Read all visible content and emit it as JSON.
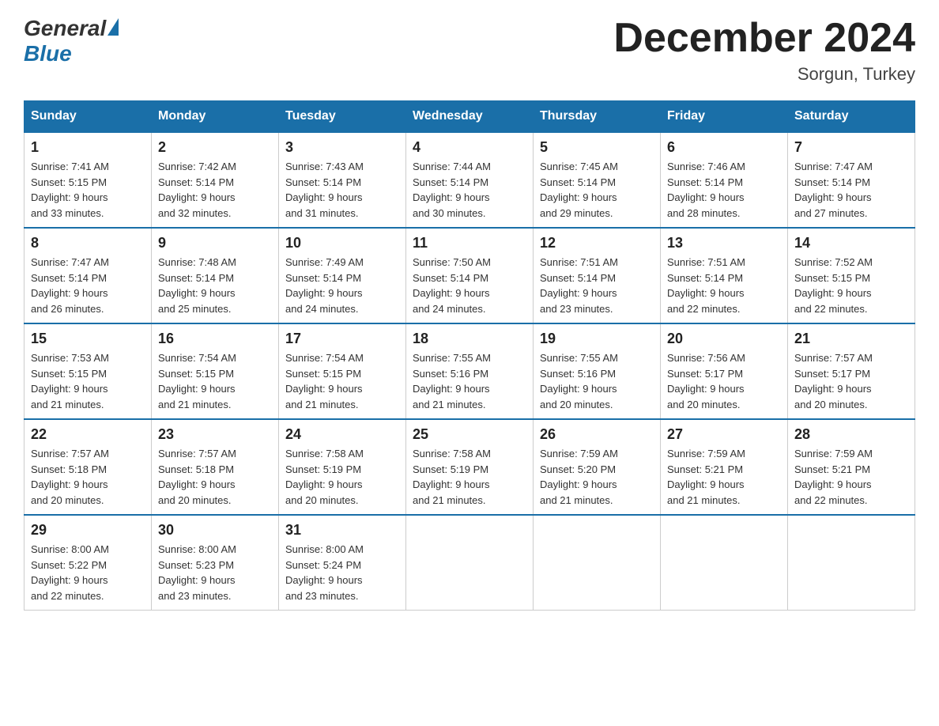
{
  "logo": {
    "general": "General",
    "blue": "Blue"
  },
  "title": "December 2024",
  "location": "Sorgun, Turkey",
  "days_header": [
    "Sunday",
    "Monday",
    "Tuesday",
    "Wednesday",
    "Thursday",
    "Friday",
    "Saturday"
  ],
  "weeks": [
    [
      {
        "day": "1",
        "sunrise": "7:41 AM",
        "sunset": "5:15 PM",
        "daylight": "9 hours and 33 minutes."
      },
      {
        "day": "2",
        "sunrise": "7:42 AM",
        "sunset": "5:14 PM",
        "daylight": "9 hours and 32 minutes."
      },
      {
        "day": "3",
        "sunrise": "7:43 AM",
        "sunset": "5:14 PM",
        "daylight": "9 hours and 31 minutes."
      },
      {
        "day": "4",
        "sunrise": "7:44 AM",
        "sunset": "5:14 PM",
        "daylight": "9 hours and 30 minutes."
      },
      {
        "day": "5",
        "sunrise": "7:45 AM",
        "sunset": "5:14 PM",
        "daylight": "9 hours and 29 minutes."
      },
      {
        "day": "6",
        "sunrise": "7:46 AM",
        "sunset": "5:14 PM",
        "daylight": "9 hours and 28 minutes."
      },
      {
        "day": "7",
        "sunrise": "7:47 AM",
        "sunset": "5:14 PM",
        "daylight": "9 hours and 27 minutes."
      }
    ],
    [
      {
        "day": "8",
        "sunrise": "7:47 AM",
        "sunset": "5:14 PM",
        "daylight": "9 hours and 26 minutes."
      },
      {
        "day": "9",
        "sunrise": "7:48 AM",
        "sunset": "5:14 PM",
        "daylight": "9 hours and 25 minutes."
      },
      {
        "day": "10",
        "sunrise": "7:49 AM",
        "sunset": "5:14 PM",
        "daylight": "9 hours and 24 minutes."
      },
      {
        "day": "11",
        "sunrise": "7:50 AM",
        "sunset": "5:14 PM",
        "daylight": "9 hours and 24 minutes."
      },
      {
        "day": "12",
        "sunrise": "7:51 AM",
        "sunset": "5:14 PM",
        "daylight": "9 hours and 23 minutes."
      },
      {
        "day": "13",
        "sunrise": "7:51 AM",
        "sunset": "5:14 PM",
        "daylight": "9 hours and 22 minutes."
      },
      {
        "day": "14",
        "sunrise": "7:52 AM",
        "sunset": "5:15 PM",
        "daylight": "9 hours and 22 minutes."
      }
    ],
    [
      {
        "day": "15",
        "sunrise": "7:53 AM",
        "sunset": "5:15 PM",
        "daylight": "9 hours and 21 minutes."
      },
      {
        "day": "16",
        "sunrise": "7:54 AM",
        "sunset": "5:15 PM",
        "daylight": "9 hours and 21 minutes."
      },
      {
        "day": "17",
        "sunrise": "7:54 AM",
        "sunset": "5:15 PM",
        "daylight": "9 hours and 21 minutes."
      },
      {
        "day": "18",
        "sunrise": "7:55 AM",
        "sunset": "5:16 PM",
        "daylight": "9 hours and 21 minutes."
      },
      {
        "day": "19",
        "sunrise": "7:55 AM",
        "sunset": "5:16 PM",
        "daylight": "9 hours and 20 minutes."
      },
      {
        "day": "20",
        "sunrise": "7:56 AM",
        "sunset": "5:17 PM",
        "daylight": "9 hours and 20 minutes."
      },
      {
        "day": "21",
        "sunrise": "7:57 AM",
        "sunset": "5:17 PM",
        "daylight": "9 hours and 20 minutes."
      }
    ],
    [
      {
        "day": "22",
        "sunrise": "7:57 AM",
        "sunset": "5:18 PM",
        "daylight": "9 hours and 20 minutes."
      },
      {
        "day": "23",
        "sunrise": "7:57 AM",
        "sunset": "5:18 PM",
        "daylight": "9 hours and 20 minutes."
      },
      {
        "day": "24",
        "sunrise": "7:58 AM",
        "sunset": "5:19 PM",
        "daylight": "9 hours and 20 minutes."
      },
      {
        "day": "25",
        "sunrise": "7:58 AM",
        "sunset": "5:19 PM",
        "daylight": "9 hours and 21 minutes."
      },
      {
        "day": "26",
        "sunrise": "7:59 AM",
        "sunset": "5:20 PM",
        "daylight": "9 hours and 21 minutes."
      },
      {
        "day": "27",
        "sunrise": "7:59 AM",
        "sunset": "5:21 PM",
        "daylight": "9 hours and 21 minutes."
      },
      {
        "day": "28",
        "sunrise": "7:59 AM",
        "sunset": "5:21 PM",
        "daylight": "9 hours and 22 minutes."
      }
    ],
    [
      {
        "day": "29",
        "sunrise": "8:00 AM",
        "sunset": "5:22 PM",
        "daylight": "9 hours and 22 minutes."
      },
      {
        "day": "30",
        "sunrise": "8:00 AM",
        "sunset": "5:23 PM",
        "daylight": "9 hours and 23 minutes."
      },
      {
        "day": "31",
        "sunrise": "8:00 AM",
        "sunset": "5:24 PM",
        "daylight": "9 hours and 23 minutes."
      },
      null,
      null,
      null,
      null
    ]
  ],
  "labels": {
    "sunrise": "Sunrise:",
    "sunset": "Sunset:",
    "daylight": "Daylight:"
  },
  "colors": {
    "header_bg": "#1a6fa8",
    "header_text": "#ffffff",
    "border": "#cccccc",
    "accent_border": "#1a6fa8"
  }
}
